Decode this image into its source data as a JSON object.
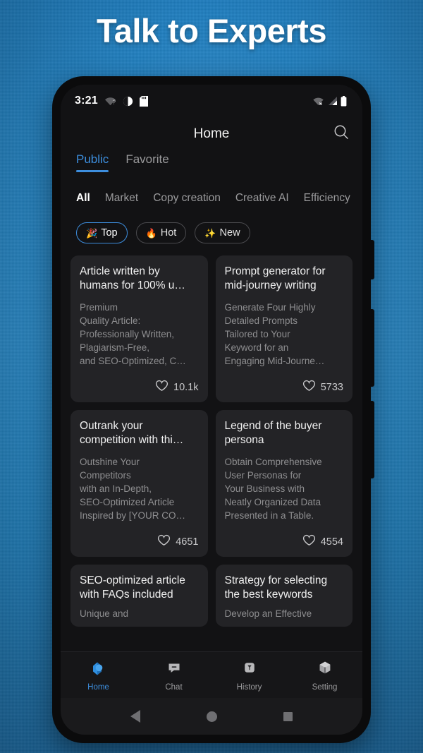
{
  "promo": {
    "headline": "Talk to Experts",
    "background_color": "#2483c2",
    "accent_color": "#3d8ede"
  },
  "status_bar": {
    "time": "3:21",
    "left_icons": [
      "wifi-question-icon",
      "do-not-disturb-icon",
      "sd-card-icon"
    ],
    "right_icons": [
      "wifi-off-icon",
      "cellular-signal-icon",
      "battery-icon"
    ]
  },
  "app_bar": {
    "title": "Home",
    "search_icon": "search-icon"
  },
  "segment_tabs": [
    {
      "label": "Public",
      "active": true
    },
    {
      "label": "Favorite",
      "active": false
    }
  ],
  "categories": [
    {
      "label": "All",
      "active": true
    },
    {
      "label": "Market",
      "active": false
    },
    {
      "label": "Copy creation",
      "active": false
    },
    {
      "label": "Creative AI",
      "active": false
    },
    {
      "label": "Efficiency",
      "active": false
    }
  ],
  "chips": [
    {
      "label": "Top",
      "emoji": "🎉",
      "icon": "party-popper-icon",
      "active": true
    },
    {
      "label": "Hot",
      "emoji": "🔥",
      "icon": "fire-icon",
      "active": false
    },
    {
      "label": "New",
      "emoji": "✨",
      "icon": "sparkles-icon",
      "active": false
    }
  ],
  "cards": [
    {
      "title": "Article written by humans for 100% u…",
      "description": "Premium\nQuality Article:\nProfessionally Written,\nPlagiarism-Free,\nand SEO-Optimized, C…",
      "likes": "10.1k"
    },
    {
      "title": "Prompt generator for mid-journey writing",
      "description": "Generate Four Highly\nDetailed Prompts\nTailored to Your\nKeyword for an\nEngaging Mid-Journe…",
      "likes": "5733"
    },
    {
      "title": "Outrank your competition with thi…",
      "description": "Outshine Your\nCompetitors\nwith an In-Depth,\nSEO-Optimized Article\nInspired by [YOUR CO…",
      "likes": "4651"
    },
    {
      "title": "Legend of the buyer persona",
      "description": "Obtain Comprehensive\nUser Personas for\nYour Business with\nNeatly Organized Data\nPresented in a Table.",
      "likes": "4554"
    },
    {
      "title": "SEO-optimized article with FAQs included",
      "description": "Unique and",
      "likes": ""
    },
    {
      "title": "Strategy for selecting the best keywords",
      "description": "Develop an Effective",
      "likes": ""
    }
  ],
  "bottom_nav": [
    {
      "label": "Home",
      "icon": "home-cube-icon",
      "active": true
    },
    {
      "label": "Chat",
      "icon": "chat-bubble-icon",
      "active": false
    },
    {
      "label": "History",
      "icon": "history-badge-icon",
      "active": false
    },
    {
      "label": "Setting",
      "icon": "cube-icon",
      "active": false
    }
  ],
  "android_nav": {
    "back": "back-triangle-icon",
    "home": "home-circle-icon",
    "recents": "recents-square-icon"
  }
}
